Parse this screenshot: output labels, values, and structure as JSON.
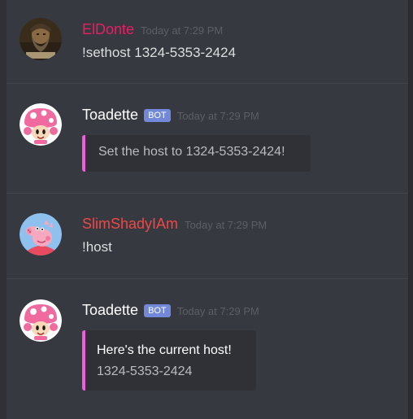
{
  "colors": {
    "background": "#36393f",
    "eldonte_name": "#e91e63",
    "toadette_name": "#ffffff",
    "slimshady_name": "#f04747",
    "bot_tag": "#7289da",
    "embed_accent": "#f05ee0"
  },
  "messages": [
    {
      "username": "ElDonte",
      "timestamp": "Today at 7:29 PM",
      "text": "!sethost 1324-5353-2424",
      "avatar": "bearded-man-avatar"
    },
    {
      "username": "Toadette",
      "bot_tag": "BOT",
      "timestamp": "Today at 7:29 PM",
      "embed_description": "Set the host to 1324-5353-2424!",
      "avatar": "toadette-avatar"
    },
    {
      "username": "SlimShadyIAm",
      "timestamp": "Today at 7:29 PM",
      "text": "!host",
      "avatar": "peppa-pig-avatar"
    },
    {
      "username": "Toadette",
      "bot_tag": "BOT",
      "timestamp": "Today at 7:29 PM",
      "embed_title": "Here's the current host!",
      "embed_description": "1324-5353-2424",
      "avatar": "toadette-avatar"
    }
  ]
}
